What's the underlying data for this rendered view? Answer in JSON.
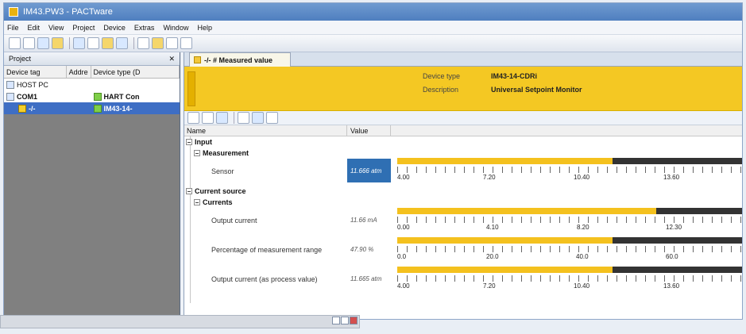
{
  "window": {
    "title": "IM43.PW3 - PACTware"
  },
  "menu": [
    "File",
    "Edit",
    "View",
    "Project",
    "Device",
    "Extras",
    "Window",
    "Help"
  ],
  "project_panel": {
    "title": "Project",
    "pin_close": " ✕",
    "columns": [
      "Device tag",
      "Addre",
      "Device type (D"
    ],
    "rows": [
      {
        "tag": "HOST PC",
        "type": ""
      },
      {
        "tag": "COM1",
        "type": "HART Con"
      },
      {
        "tag": "-/-",
        "type": "IM43-14-"
      }
    ]
  },
  "tab": {
    "label": "-/- # Measured value"
  },
  "device": {
    "type_label": "Device type",
    "type_value": "IM43-14-CDRi",
    "description_label": "Description",
    "description_value": "Universal Setpoint Monitor"
  },
  "grid": {
    "col_name": "Name",
    "col_value": "Value",
    "input_group": "Input",
    "measurement_group": "Measurement",
    "sensor_label": "Sensor",
    "sensor_value": "11.666 atm",
    "current_source_group": "Current source",
    "currents_group": "Currents",
    "output_current_label": "Output current",
    "output_current_value": "11.66 mA",
    "percentage_label": "Percentage of measurement range",
    "percentage_value": "47.90 %",
    "process_label": "Output current (as process value)",
    "process_value": "11.665 atm"
  },
  "bars": [
    {
      "fraction": 0.621,
      "ticks": [
        "4.00",
        "7.20",
        "10.40",
        "13.60"
      ]
    },
    {
      "fraction": 0.745,
      "ticks": [
        "0.00",
        "4.10",
        "8.20",
        "12.30"
      ]
    },
    {
      "fraction": 0.621,
      "ticks": [
        "0.0",
        "20.0",
        "40.0",
        "60.0"
      ]
    },
    {
      "fraction": 0.621,
      "ticks": [
        "4.00",
        "7.20",
        "10.40",
        "13.60"
      ]
    }
  ]
}
